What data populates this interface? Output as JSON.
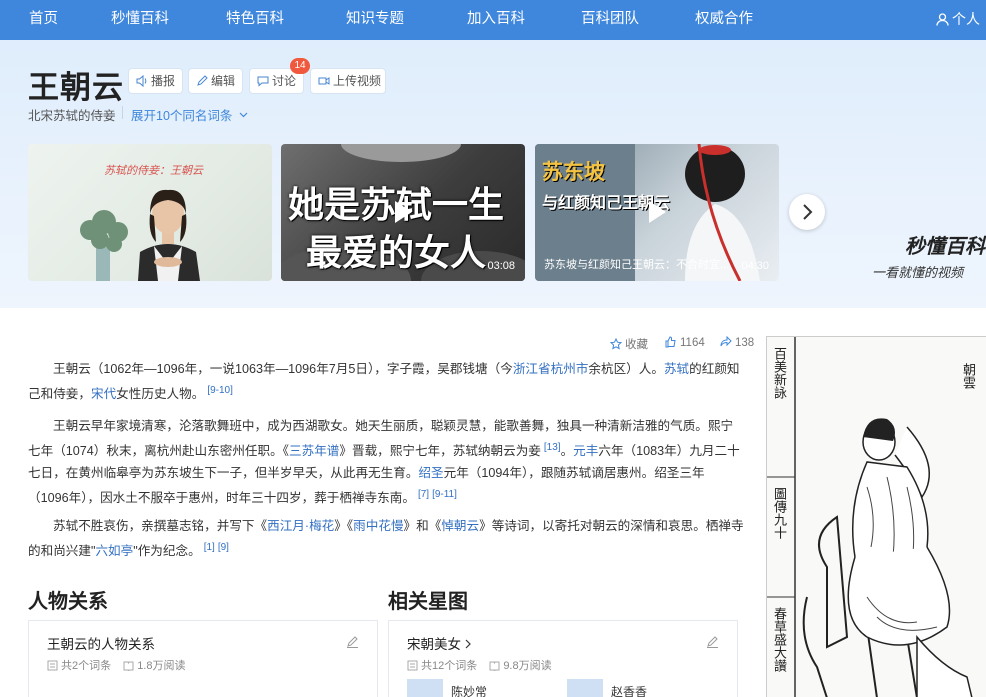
{
  "nav": {
    "items": [
      "首页",
      "秒懂百科",
      "特色百科",
      "知识专题",
      "加入百科",
      "百科团队",
      "权威合作"
    ],
    "user_label": "个人"
  },
  "header": {
    "title": "王朝云",
    "actions": {
      "play": "播报",
      "edit": "编辑",
      "discuss": "讨论",
      "discuss_count": "14",
      "upload": "上传视频"
    },
    "subtitle": "北宋苏轼的侍妾",
    "expand": "展开10个同名词条"
  },
  "videos": [
    {
      "overlay_text": "苏轼的侍妾：王朝云",
      "duration": "",
      "caption": ""
    },
    {
      "overlay_line1": "她是苏轼一生",
      "overlay_line2": "最爱的女人",
      "duration": "03:08",
      "caption": ""
    },
    {
      "overlay_title": "苏东坡",
      "overlay_sub": "与红颜知己王朝云",
      "duration": "04:30",
      "caption": "苏东坡与红颜知己王朝云：不合时宜..."
    }
  ],
  "brand": {
    "logo": "秒懂百科",
    "slogan": "一看就懂的视频"
  },
  "stats": {
    "collect": "收藏",
    "likes": "1164",
    "shares": "138"
  },
  "paragraphs": {
    "p1": {
      "t1": "王朝云（1062年—1096年，一说1063年—1096年7月5日），字子霞，吴郡钱塘（今",
      "l1": "浙江省杭州市",
      "t2": "余杭区）人。",
      "l2": "苏轼",
      "t3": "的红颜知己和侍妾，",
      "l3": "宋代",
      "t4": "女性历史人物。",
      "r1": "[9-10]"
    },
    "p2": {
      "t1": "王朝云早年家境清寒，沦落歌舞班中，成为西湖歌女。她天生丽质，聪颖灵慧，能歌善舞，独具一种清新洁雅的气质。熙宁七年（1074）秋末，离杭州赴山东密州任职。《",
      "l1": "三苏年谱",
      "t2": "》晋载，熙宁七年，苏轼纳朝云为妾",
      "r1": "[13]",
      "t3": "。",
      "l2": "元丰",
      "t4": "六年（1083年）九月二十七日，在黄州临皋亭为苏东坡生下一子，但半岁早夭，从此再无生育。",
      "l3": "绍圣",
      "t5": "元年（1094年），跟随苏轼谪居惠州。绍圣三年（1096年），因水土不服卒于惠州，时年三十四岁，葬于栖禅寺东南。",
      "r2": "[7]",
      "r3": "[9-11]"
    },
    "p3": {
      "t1": "苏轼不胜哀伤，亲撰墓志铭，并写下《",
      "l1": "西江月·梅花",
      "t2": "》《",
      "l2": "雨中花慢",
      "t3": "》和《",
      "l3": "悼朝云",
      "t4": "》等诗词，以寄托对朝云的深情和哀思。栖禅寺的和尚兴建\"",
      "l4": "六如亭",
      "t5": "\"作为纪念。",
      "r1": "[1]",
      "r2": "[9]"
    }
  },
  "illustration": {
    "col1": "朝雲",
    "col2": "百美新詠",
    "col3": "圖傳九十",
    "col4": "春草盛大讚"
  },
  "relations": {
    "section_title": "人物关系",
    "card_title": "王朝云的人物关系",
    "entries": "共2个词条",
    "reads": "1.8万阅读"
  },
  "stars": {
    "section_title": "相关星图",
    "card_title": "宋朝美女",
    "entries": "共12个词条",
    "reads": "9.8万阅读",
    "people": [
      "陈妙常",
      "赵香香"
    ]
  },
  "colors": {
    "nav_bg": "#3f87dc",
    "link": "#3370c2",
    "badge": "#f0593d"
  }
}
